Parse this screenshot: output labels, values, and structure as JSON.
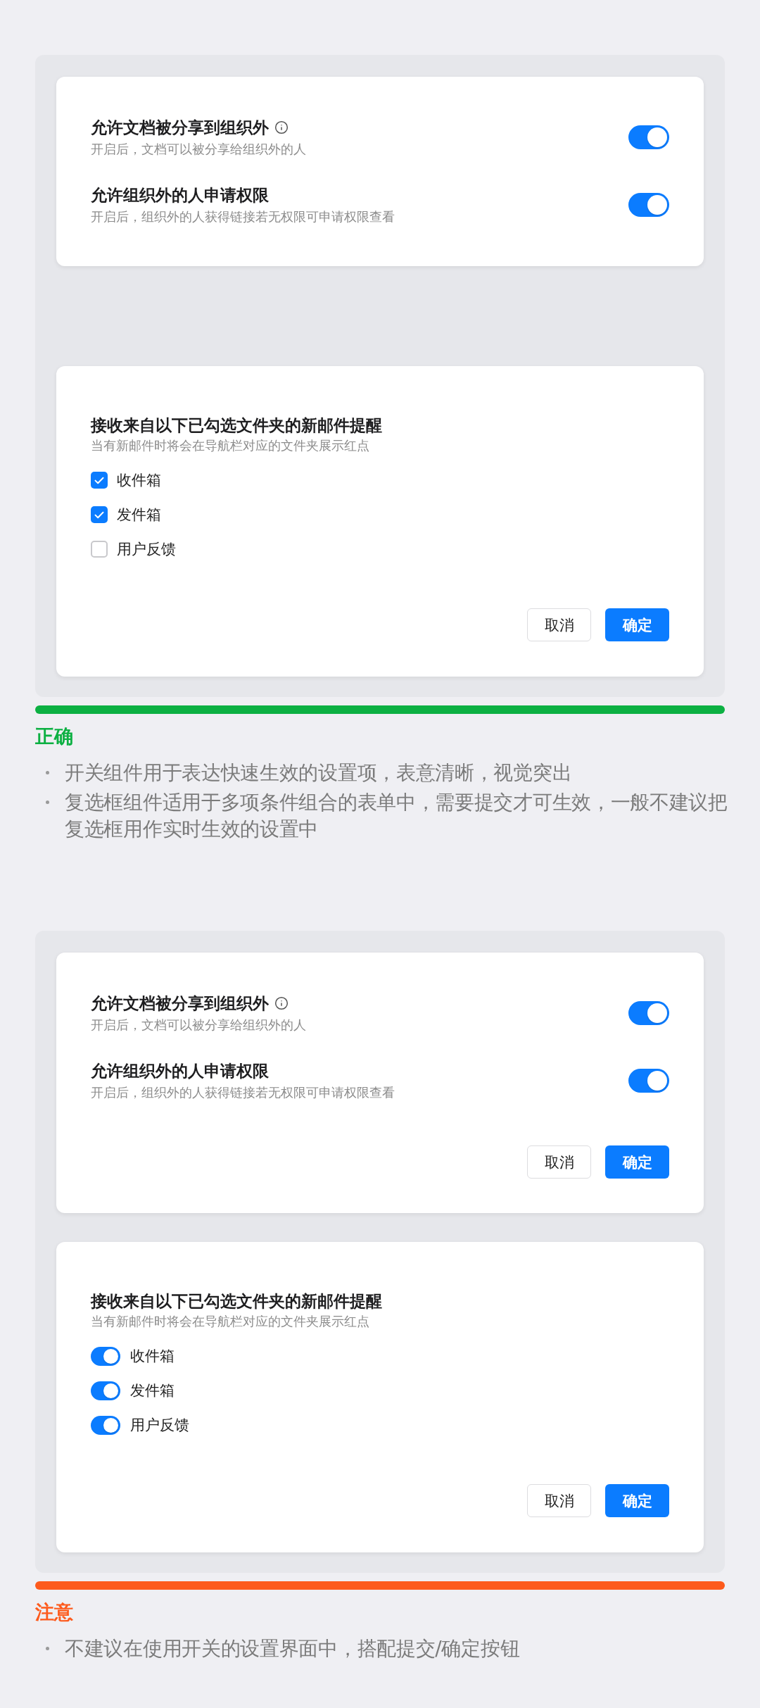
{
  "sections": [
    {
      "kind": "correct",
      "cards": [
        {
          "kind": "switches",
          "rows": [
            {
              "title": "允许文档被分享到组织外",
              "info": true,
              "description": "开启后，文档可以被分享给组织外的人",
              "on": true
            },
            {
              "title": "允许组织外的人申请权限",
              "info": false,
              "description": "开启后，组织外的人获得链接若无权限可申请权限查看",
              "on": true
            }
          ]
        },
        {
          "kind": "options",
          "title": "接收来自以下已勾选文件夹的新邮件提醒",
          "description": "当有新邮件时将会在导航栏对应的文件夹展示红点",
          "options": [
            {
              "kind": "checkbox",
              "label": "收件箱",
              "checked": true
            },
            {
              "kind": "checkbox",
              "label": "发件箱",
              "checked": true
            },
            {
              "kind": "checkbox",
              "label": "用户反馈",
              "checked": false
            }
          ],
          "buttons": [
            {
              "kind": "secondary",
              "label": "取消"
            },
            {
              "kind": "primary",
              "label": "确定"
            }
          ]
        }
      ],
      "verdict": "正确",
      "notes": [
        "开关组件用于表达快速生效的设置项，表意清晰，视觉突出",
        "复选框组件适用于多项条件组合的表单中，需要提交才可生效，一般不建议把复选框用作实时生效的设置中"
      ]
    },
    {
      "kind": "caution",
      "cards": [
        {
          "kind": "switches",
          "rows": [
            {
              "title": "允许文档被分享到组织外",
              "info": true,
              "description": "开启后，文档可以被分享给组织外的人",
              "on": true
            },
            {
              "title": "允许组织外的人申请权限",
              "info": false,
              "description": "开启后，组织外的人获得链接若无权限可申请权限查看",
              "on": true
            }
          ],
          "buttons": [
            {
              "kind": "secondary",
              "label": "取消"
            },
            {
              "kind": "primary",
              "label": "确定"
            }
          ]
        },
        {
          "kind": "options",
          "title": "接收来自以下已勾选文件夹的新邮件提醒",
          "description": "当有新邮件时将会在导航栏对应的文件夹展示红点",
          "options": [
            {
              "kind": "switch",
              "label": "收件箱",
              "on": true
            },
            {
              "kind": "switch",
              "label": "发件箱",
              "on": true
            },
            {
              "kind": "switch",
              "label": "用户反馈",
              "on": true
            }
          ],
          "buttons": [
            {
              "kind": "secondary",
              "label": "取消"
            },
            {
              "kind": "primary",
              "label": "确定"
            }
          ]
        }
      ],
      "verdict": "注意",
      "notes": [
        "不建议在使用开关的设置界面中，搭配提交/确定按钮"
      ]
    }
  ]
}
